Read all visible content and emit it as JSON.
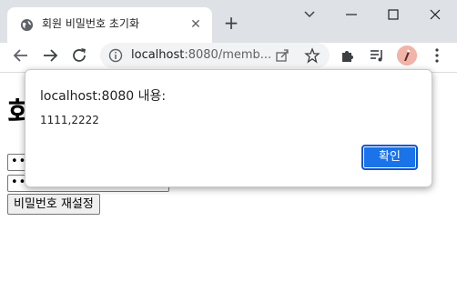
{
  "browser": {
    "tab": {
      "title": "회원 비밀번호 초기화",
      "favicon": "globe-icon"
    },
    "address_bar": {
      "host": "localhost",
      "rest": ":8080/memb..."
    },
    "colors": {
      "titlebar": "#dee1e6",
      "accent": "#1a73e8"
    }
  },
  "page": {
    "heading_visible": "회",
    "password_field_1_value": "•••",
    "password_field_2_value": "•••",
    "reset_button_label": "비밀번호 재설정"
  },
  "dialog": {
    "title": "localhost:8080 내용:",
    "message": "1111,2222",
    "ok_label": "확인"
  }
}
